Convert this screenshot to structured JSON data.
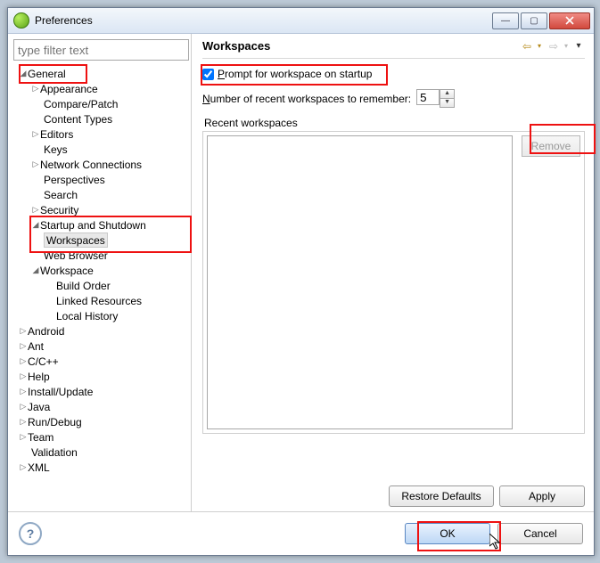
{
  "window": {
    "title": "Preferences"
  },
  "win_buttons": {
    "min": "—",
    "max": "▢"
  },
  "filter_placeholder": "type filter text",
  "tree": {
    "general": "General",
    "appearance": "Appearance",
    "compare": "Compare/Patch",
    "content_types": "Content Types",
    "editors": "Editors",
    "keys": "Keys",
    "network": "Network Connections",
    "perspectives": "Perspectives",
    "search": "Search",
    "security": "Security",
    "startup": "Startup and Shutdown",
    "workspaces": "Workspaces",
    "web_browser": "Web Browser",
    "workspace": "Workspace",
    "build_order": "Build Order",
    "linked_res": "Linked Resources",
    "local_history": "Local History",
    "android": "Android",
    "ant": "Ant",
    "cpp": "C/C++",
    "help": "Help",
    "install": "Install/Update",
    "java": "Java",
    "rundebug": "Run/Debug",
    "team": "Team",
    "validation": "Validation",
    "xml": "XML"
  },
  "page": {
    "title": "Workspaces",
    "prompt_label_first": "P",
    "prompt_label_rest": "rompt for workspace on startup",
    "prompt_checked": true,
    "recent_label_first": "N",
    "recent_label_rest": "umber of recent workspaces to remember:",
    "recent_count": "5",
    "group_label": "Recent workspaces",
    "remove": "Remove",
    "restore": "Restore Defaults",
    "apply": "Apply"
  },
  "footer": {
    "ok": "OK",
    "cancel": "Cancel"
  }
}
